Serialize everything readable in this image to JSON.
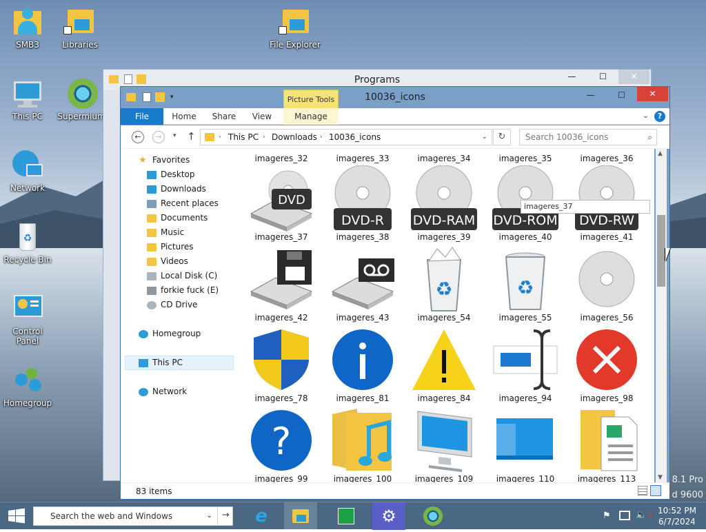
{
  "desktop": {
    "icons": [
      {
        "label": "SMB3",
        "icon": "user-folder-icon"
      },
      {
        "label": "Libraries",
        "icon": "libraries-icon"
      },
      {
        "label": "File Explorer",
        "icon": "file-explorer-icon"
      },
      {
        "label": "This PC",
        "icon": "computer-icon"
      },
      {
        "label": "Supermium",
        "icon": "browser-icon"
      },
      {
        "label": "Network",
        "icon": "network-icon"
      },
      {
        "label": "Recycle Bin",
        "icon": "recycle-bin-icon"
      },
      {
        "label": "Control Panel",
        "icon": "control-panel-icon"
      },
      {
        "label": "Homegroup",
        "icon": "homegroup-icon"
      }
    ],
    "watermark": {
      "line1": "8.1 Pro",
      "line2": "d 9600"
    }
  },
  "back_window": {
    "title": "Programs",
    "min": "—",
    "max": "☐",
    "close": "✕"
  },
  "explorer": {
    "title": "10036_icons",
    "contextual_group": "Picture Tools",
    "tabs": [
      "File",
      "Home",
      "Share",
      "View",
      "Manage"
    ],
    "breadcrumb": [
      "This PC",
      "Downloads",
      "10036_icons"
    ],
    "search_placeholder": "Search 10036_icons",
    "nav": {
      "favorites": "Favorites",
      "items": [
        "Desktop",
        "Downloads",
        "Recent places",
        "Documents",
        "Music",
        "Pictures",
        "Videos",
        "Local Disk (C)",
        "forkie fuck (E)",
        "CD Drive"
      ],
      "homegroup": "Homegroup",
      "thispc": "This PC",
      "network": "Network"
    },
    "top_labels": [
      "imageres_32",
      "imageres_33",
      "imageres_34",
      "imageres_35",
      "imageres_36"
    ],
    "rows": [
      [
        "imageres_37",
        "imageres_38",
        "imageres_39",
        "imageres_40",
        "imageres_41"
      ],
      [
        "imageres_42",
        "imageres_43",
        "imageres_54",
        "imageres_55",
        "imageres_56"
      ],
      [
        "imageres_78",
        "imageres_81",
        "imageres_84",
        "imageres_94",
        "imageres_98"
      ],
      [
        "imageres_99",
        "imageres_100",
        "imageres_109",
        "imageres_110",
        "imageres_113"
      ]
    ],
    "disc_labels": [
      "DVD",
      "DVD-R",
      "DVD-RAM",
      "DVD-ROM",
      "DVD-RW"
    ],
    "tooltip": "imageres_37",
    "status": "83 items"
  },
  "taskbar": {
    "search_placeholder": "Search the web and Windows",
    "time": "10:52 PM",
    "date": "6/7/2024"
  },
  "colors": {
    "accent": "#1979ca",
    "taskbar": "#4a6783",
    "close": "#d9413b",
    "titlebar": "#7aa0c8"
  }
}
